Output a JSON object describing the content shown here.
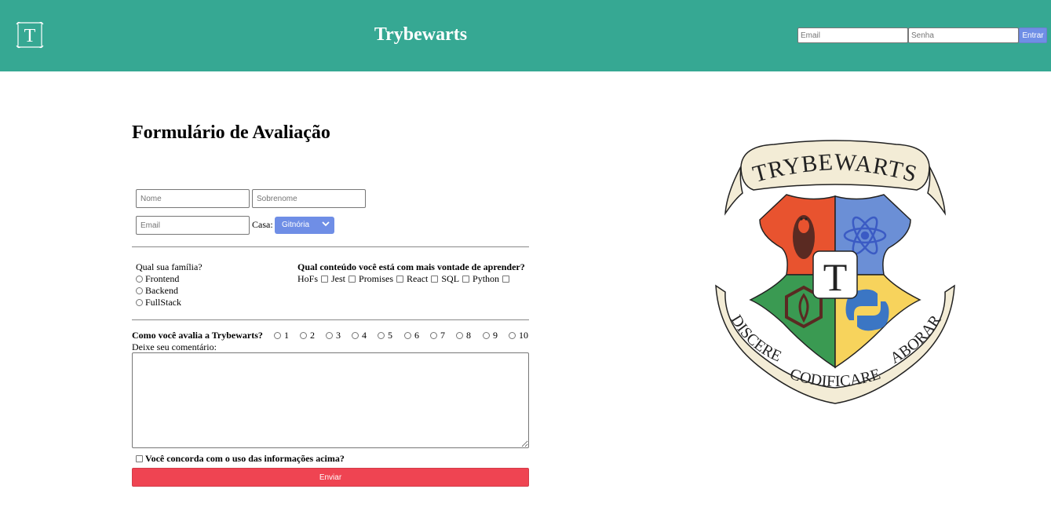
{
  "header": {
    "brand_initial": "T",
    "title": "Trybewarts",
    "login": {
      "email_placeholder": "Email",
      "password_placeholder": "Senha",
      "submit_label": "Entrar"
    },
    "background_color": "#36a893"
  },
  "form": {
    "title": "Formulário de Avaliação",
    "name_placeholder": "Nome",
    "lastname_placeholder": "Sobrenome",
    "email_placeholder": "Email",
    "house_label": "Casa:",
    "house_selected": "Gitnória",
    "family": {
      "question": "Qual sua família?",
      "options": [
        "Frontend",
        "Backend",
        "FullStack"
      ]
    },
    "subjects": {
      "question": "Qual conteúdo você está com mais vontade de aprender?",
      "options": [
        "HoFs",
        "Jest",
        "Promises",
        "React",
        "SQL",
        "Python"
      ]
    },
    "rating": {
      "question": "Como você avalia a Trybewarts?",
      "options": [
        "1",
        "2",
        "3",
        "4",
        "5",
        "6",
        "7",
        "8",
        "9",
        "10"
      ]
    },
    "comment_label": "Deixe seu comentário:",
    "agreement_label": "Você concorda com o uso das informações acima?",
    "submit_label": "Enviar",
    "submit_color": "#ef4452",
    "select_color": "#6f8ee6"
  },
  "crest": {
    "banner_text": "TRYBEWARTS",
    "center_letter": "T",
    "motto": [
      "DISCERE",
      "CODIFICARE",
      "LABORARE"
    ],
    "quadrant_colors": [
      "#e8532f",
      "#6b8fd6",
      "#3a9a52",
      "#f7d35c"
    ],
    "icons": [
      "linux-penguin-icon",
      "react-atom-icon",
      "nodejs-hexagon-icon",
      "python-icon"
    ]
  }
}
